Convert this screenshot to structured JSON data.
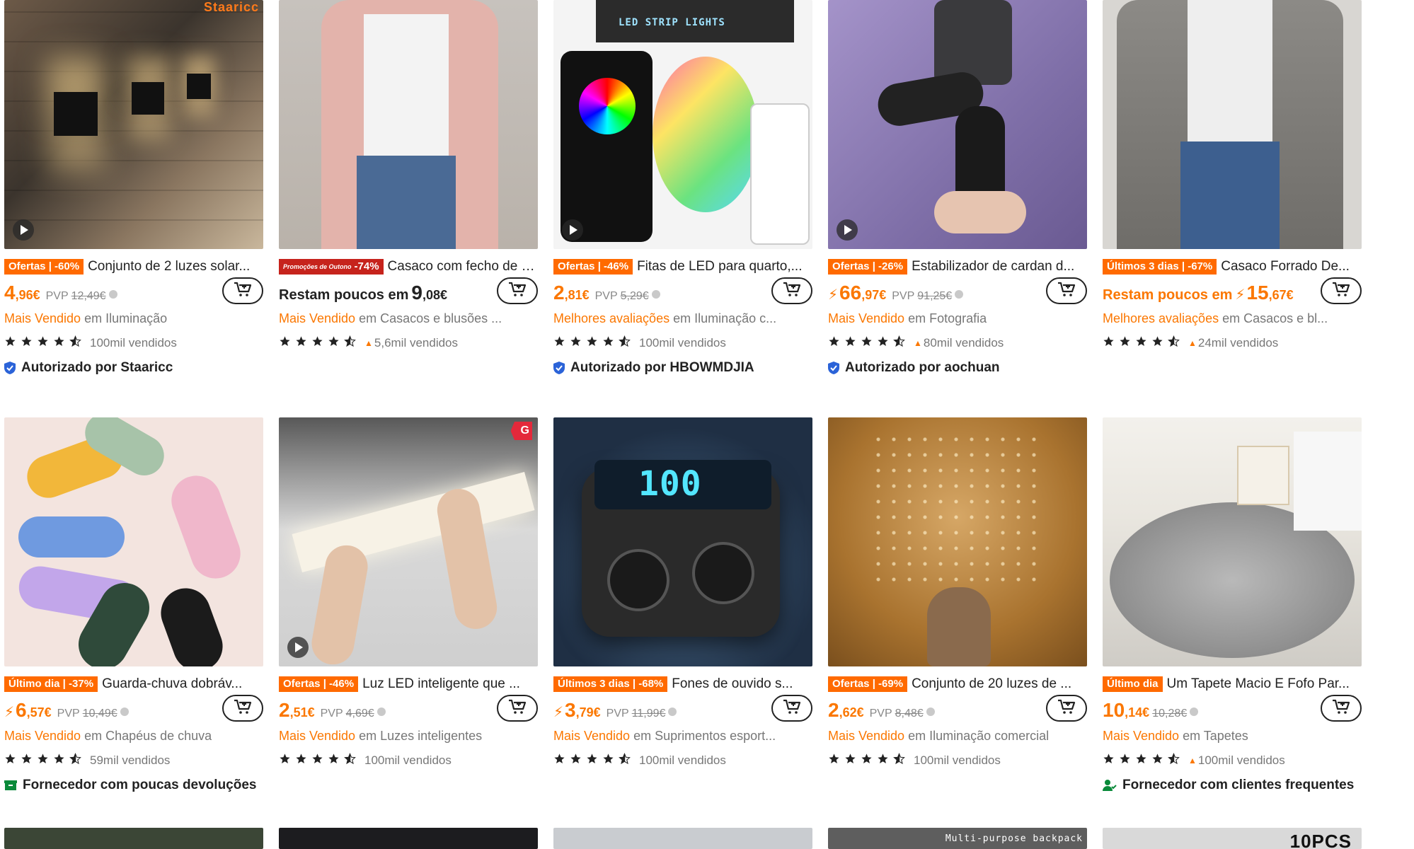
{
  "colors": {
    "accent": "#fb7701",
    "badge_orange": "#ff6a00",
    "badge_red": "#c6231c",
    "text": "#222222",
    "muted": "#777777",
    "verified_blue": "#2b63d8",
    "green": "#0a8a3a"
  },
  "products": [
    {
      "badge": "Ofertas | -60%",
      "title": "Conjunto de 2 luzes solar...",
      "price_int": "4",
      "price_dec": ",96€",
      "pvp_label": "PVP",
      "old_price": "12,49€",
      "rank_highlight": "Mais Vendido",
      "rank_rest": " em Iluminação",
      "rating": 4.5,
      "sold": "100mil vendidos",
      "seller": "Autorizado por Staaricc",
      "seller_icon": "verified-shield-icon",
      "has_video": true,
      "image_text": "Staaricc"
    },
    {
      "badge_season": "Promoções de Outono",
      "badge": "-74%",
      "title": "Casaco com fecho de c...",
      "rest_label": "Restam poucos em",
      "price_int": "9",
      "price_dec": ",08€",
      "rank_highlight": "Mais Vendido",
      "rank_rest": " em Casacos e blusões ...",
      "rating": 4.5,
      "sold": "5,6mil vendidos",
      "hot": true
    },
    {
      "badge": "Ofertas | -46%",
      "title": "Fitas de LED para quarto,...",
      "price_int": "2",
      "price_dec": ",81€",
      "pvp_label": "PVP",
      "old_price": "5,29€",
      "rank_highlight": "Melhores avaliações",
      "rank_rest": " em Iluminação c...",
      "rating": 4.5,
      "sold": "100mil vendidos",
      "seller": "Autorizado por HBOWMDJIA",
      "seller_icon": "verified-shield-icon",
      "has_video": true,
      "image_text": "LED STRIP LIGHTS"
    },
    {
      "badge": "Ofertas | -26%",
      "title": "Estabilizador de cardan d...",
      "flash": true,
      "price_int": "66",
      "price_dec": ",97€",
      "pvp_label": "PVP",
      "old_price": "91,25€",
      "rank_highlight": "Mais Vendido",
      "rank_rest": " em Fotografia",
      "rating": 4.5,
      "sold": "80mil vendidos",
      "hot": true,
      "seller": "Autorizado por aochuan",
      "seller_icon": "verified-shield-icon",
      "has_video": true
    },
    {
      "badge": "Últimos 3 dias | -67%",
      "title": "Casaco Forrado De...",
      "rest_label": "Restam poucos em",
      "rest_orange": true,
      "flash": true,
      "price_int": "15",
      "price_dec": ",67€",
      "rank_highlight": "Melhores avaliações",
      "rank_rest": " em Casacos e bl...",
      "rating": 4.5,
      "sold": "24mil vendidos",
      "hot": true
    },
    {
      "badge": "Último dia | -37%",
      "title": "Guarda-chuva dobráv...",
      "flash": true,
      "price_int": "6",
      "price_dec": ",57€",
      "pvp_label": "PVP",
      "old_price": "10,49€",
      "rank_highlight": "Mais Vendido",
      "rank_rest": " em Chapéus de chuva",
      "rating": 4.5,
      "sold": "59mil vendidos",
      "seller": "Fornecedor com poucas devoluções",
      "seller_icon": "return-box-icon"
    },
    {
      "badge": "Ofertas | -46%",
      "title": "Luz LED inteligente que ...",
      "price_int": "2",
      "price_dec": ",51€",
      "pvp_label": "PVP",
      "old_price": "4,69€",
      "rank_highlight": "Mais Vendido",
      "rank_rest": " em Luzes inteligentes",
      "rating": 4.5,
      "sold": "100mil vendidos",
      "has_video": true,
      "corner_badge": "G"
    },
    {
      "badge": "Últimos 3 dias | -68%",
      "title": "Fones de ouvido s...",
      "flash": true,
      "price_int": "3",
      "price_dec": ",79€",
      "pvp_label": "PVP",
      "old_price": "11,99€",
      "rank_highlight": "Mais Vendido",
      "rank_rest": " em Suprimentos esport...",
      "rating": 4.5,
      "sold": "100mil vendidos",
      "image_text": "100"
    },
    {
      "badge": "Ofertas | -69%",
      "title": "Conjunto de 20 luzes de ...",
      "price_int": "2",
      "price_dec": ",62€",
      "pvp_label": "PVP",
      "old_price": "8,48€",
      "rank_highlight": "Mais Vendido",
      "rank_rest": " em Iluminação comercial",
      "rating": 4.5,
      "sold": "100mil vendidos"
    },
    {
      "badge": "Último dia",
      "title": "Um Tapete Macio E Fofo Par...",
      "price_int": "10",
      "price_dec": ",14€",
      "old_price": "10,28€",
      "rank_highlight": "Mais Vendido",
      "rank_rest": " em Tapetes",
      "rating": 4.5,
      "sold": "100mil vendidos",
      "hot": true,
      "seller": "Fornecedor com clientes frequentes",
      "seller_icon": "repeat-customers-icon"
    }
  ],
  "partial_row_texts": [
    "Multi-purpose backpack",
    "10PCS"
  ]
}
